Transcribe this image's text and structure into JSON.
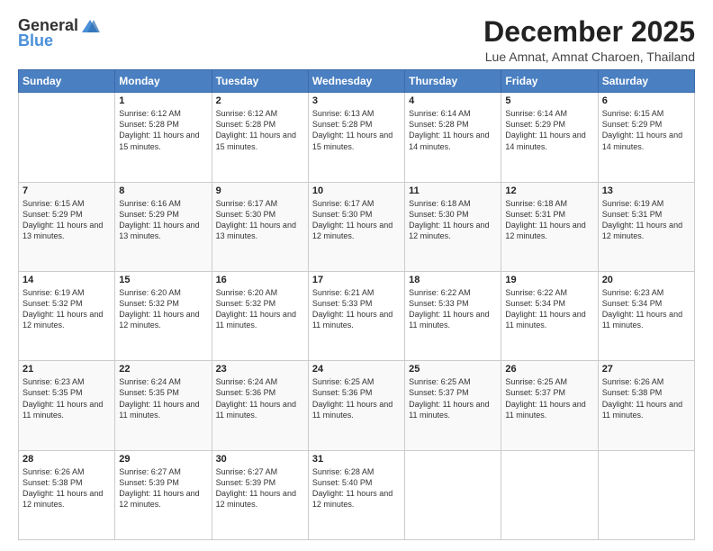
{
  "logo": {
    "general": "General",
    "blue": "Blue"
  },
  "title": "December 2025",
  "location": "Lue Amnat, Amnat Charoen, Thailand",
  "days_of_week": [
    "Sunday",
    "Monday",
    "Tuesday",
    "Wednesday",
    "Thursday",
    "Friday",
    "Saturday"
  ],
  "weeks": [
    [
      {
        "day": "",
        "sunrise": "",
        "sunset": "",
        "daylight": ""
      },
      {
        "day": "1",
        "sunrise": "6:12 AM",
        "sunset": "5:28 PM",
        "daylight": "11 hours and 15 minutes."
      },
      {
        "day": "2",
        "sunrise": "6:12 AM",
        "sunset": "5:28 PM",
        "daylight": "11 hours and 15 minutes."
      },
      {
        "day": "3",
        "sunrise": "6:13 AM",
        "sunset": "5:28 PM",
        "daylight": "11 hours and 15 minutes."
      },
      {
        "day": "4",
        "sunrise": "6:14 AM",
        "sunset": "5:28 PM",
        "daylight": "11 hours and 14 minutes."
      },
      {
        "day": "5",
        "sunrise": "6:14 AM",
        "sunset": "5:29 PM",
        "daylight": "11 hours and 14 minutes."
      },
      {
        "day": "6",
        "sunrise": "6:15 AM",
        "sunset": "5:29 PM",
        "daylight": "11 hours and 14 minutes."
      }
    ],
    [
      {
        "day": "7",
        "sunrise": "6:15 AM",
        "sunset": "5:29 PM",
        "daylight": "11 hours and 13 minutes."
      },
      {
        "day": "8",
        "sunrise": "6:16 AM",
        "sunset": "5:29 PM",
        "daylight": "11 hours and 13 minutes."
      },
      {
        "day": "9",
        "sunrise": "6:17 AM",
        "sunset": "5:30 PM",
        "daylight": "11 hours and 13 minutes."
      },
      {
        "day": "10",
        "sunrise": "6:17 AM",
        "sunset": "5:30 PM",
        "daylight": "11 hours and 12 minutes."
      },
      {
        "day": "11",
        "sunrise": "6:18 AM",
        "sunset": "5:30 PM",
        "daylight": "11 hours and 12 minutes."
      },
      {
        "day": "12",
        "sunrise": "6:18 AM",
        "sunset": "5:31 PM",
        "daylight": "11 hours and 12 minutes."
      },
      {
        "day": "13",
        "sunrise": "6:19 AM",
        "sunset": "5:31 PM",
        "daylight": "11 hours and 12 minutes."
      }
    ],
    [
      {
        "day": "14",
        "sunrise": "6:19 AM",
        "sunset": "5:32 PM",
        "daylight": "11 hours and 12 minutes."
      },
      {
        "day": "15",
        "sunrise": "6:20 AM",
        "sunset": "5:32 PM",
        "daylight": "11 hours and 12 minutes."
      },
      {
        "day": "16",
        "sunrise": "6:20 AM",
        "sunset": "5:32 PM",
        "daylight": "11 hours and 11 minutes."
      },
      {
        "day": "17",
        "sunrise": "6:21 AM",
        "sunset": "5:33 PM",
        "daylight": "11 hours and 11 minutes."
      },
      {
        "day": "18",
        "sunrise": "6:22 AM",
        "sunset": "5:33 PM",
        "daylight": "11 hours and 11 minutes."
      },
      {
        "day": "19",
        "sunrise": "6:22 AM",
        "sunset": "5:34 PM",
        "daylight": "11 hours and 11 minutes."
      },
      {
        "day": "20",
        "sunrise": "6:23 AM",
        "sunset": "5:34 PM",
        "daylight": "11 hours and 11 minutes."
      }
    ],
    [
      {
        "day": "21",
        "sunrise": "6:23 AM",
        "sunset": "5:35 PM",
        "daylight": "11 hours and 11 minutes."
      },
      {
        "day": "22",
        "sunrise": "6:24 AM",
        "sunset": "5:35 PM",
        "daylight": "11 hours and 11 minutes."
      },
      {
        "day": "23",
        "sunrise": "6:24 AM",
        "sunset": "5:36 PM",
        "daylight": "11 hours and 11 minutes."
      },
      {
        "day": "24",
        "sunrise": "6:25 AM",
        "sunset": "5:36 PM",
        "daylight": "11 hours and 11 minutes."
      },
      {
        "day": "25",
        "sunrise": "6:25 AM",
        "sunset": "5:37 PM",
        "daylight": "11 hours and 11 minutes."
      },
      {
        "day": "26",
        "sunrise": "6:25 AM",
        "sunset": "5:37 PM",
        "daylight": "11 hours and 11 minutes."
      },
      {
        "day": "27",
        "sunrise": "6:26 AM",
        "sunset": "5:38 PM",
        "daylight": "11 hours and 11 minutes."
      }
    ],
    [
      {
        "day": "28",
        "sunrise": "6:26 AM",
        "sunset": "5:38 PM",
        "daylight": "11 hours and 12 minutes."
      },
      {
        "day": "29",
        "sunrise": "6:27 AM",
        "sunset": "5:39 PM",
        "daylight": "11 hours and 12 minutes."
      },
      {
        "day": "30",
        "sunrise": "6:27 AM",
        "sunset": "5:39 PM",
        "daylight": "11 hours and 12 minutes."
      },
      {
        "day": "31",
        "sunrise": "6:28 AM",
        "sunset": "5:40 PM",
        "daylight": "11 hours and 12 minutes."
      },
      {
        "day": "",
        "sunrise": "",
        "sunset": "",
        "daylight": ""
      },
      {
        "day": "",
        "sunrise": "",
        "sunset": "",
        "daylight": ""
      },
      {
        "day": "",
        "sunrise": "",
        "sunset": "",
        "daylight": ""
      }
    ]
  ],
  "labels": {
    "sunrise_prefix": "Sunrise: ",
    "sunset_prefix": "Sunset: ",
    "daylight_prefix": "Daylight: "
  }
}
